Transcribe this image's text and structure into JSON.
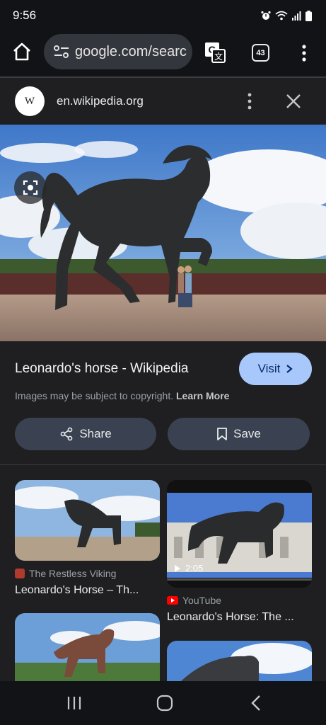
{
  "status": {
    "time": "9:56"
  },
  "toolbar": {
    "url": "google.com/searc",
    "tab_count": "43"
  },
  "panel": {
    "site_logo": "W",
    "site": "en.wikipedia.org",
    "title": "Leonardo's horse - Wikipedia",
    "visit_label": "Visit",
    "copyright": "Images may be subject to copyright.",
    "learn_more": "Learn More",
    "share_label": "Share",
    "save_label": "Save"
  },
  "related": [
    {
      "source": "The Restless Viking",
      "title": "Leonardo's Horse – Th..."
    },
    {
      "source": "YouTube",
      "title": "Leonardo's Horse: The ...",
      "duration": "2:05"
    }
  ],
  "colors": {
    "accent": "#a8c7fa",
    "background": "#1f1f21",
    "chip": "#3a4150"
  }
}
